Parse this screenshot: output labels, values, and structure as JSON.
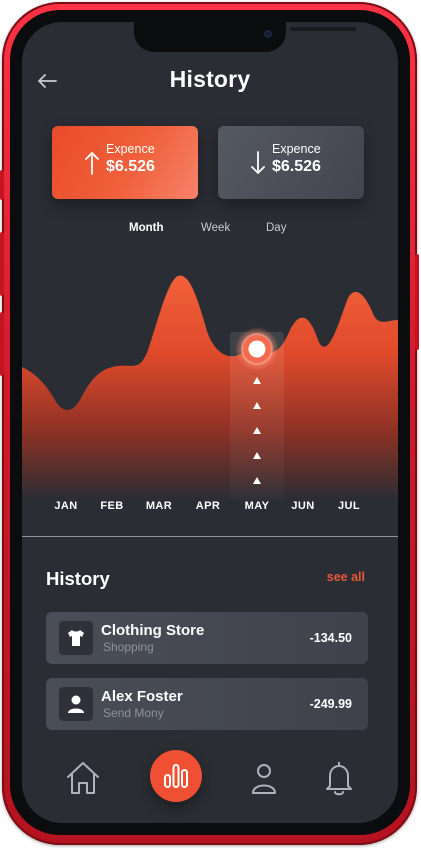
{
  "header": {
    "title": "History"
  },
  "cards": [
    {
      "label": "Expence",
      "amount": "$6.526",
      "direction": "arrow-up-icon"
    },
    {
      "label": "Expence",
      "amount": "$6.526",
      "direction": "arrow-down-icon"
    }
  ],
  "period_tabs": [
    {
      "label": "Month",
      "active": true
    },
    {
      "label": "Week",
      "active": false
    },
    {
      "label": "Day",
      "active": false
    }
  ],
  "chart_data": {
    "type": "area",
    "categories": [
      "JAN",
      "FEB",
      "MAR",
      "APR",
      "MAY",
      "JUN",
      "JUL"
    ],
    "selected_category": "MAY",
    "y_axis_labels": "none",
    "colors": {
      "fill_top": "#f05a35",
      "fill_bottom": "#2a2d33",
      "marker": "#ffffff"
    }
  },
  "history": {
    "heading": "History",
    "see_all": "see all",
    "transactions": [
      {
        "name": "Clothing Store",
        "category": "Shopping",
        "amount": "-134.50",
        "icon": "tshirt-icon"
      },
      {
        "name": "Alex Foster",
        "category": "Send Mony",
        "amount": "-249.99",
        "icon": "user-icon"
      }
    ]
  },
  "nav": [
    {
      "icon": "home-icon"
    },
    {
      "icon": "chart-icon",
      "active": true
    },
    {
      "icon": "profile-icon"
    },
    {
      "icon": "bell-icon"
    }
  ],
  "colors": {
    "accent": "#ef5033",
    "background": "#2a2d33",
    "card_secondary": "#4a4e57"
  }
}
